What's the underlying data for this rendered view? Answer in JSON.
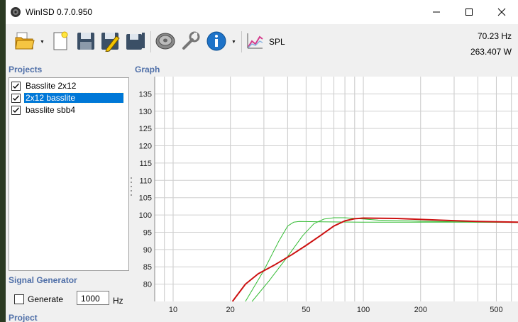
{
  "window": {
    "title": "WinISD 0.7.0.950"
  },
  "toolbar": {
    "spl_label": "SPL",
    "freq_readout": "70.23 Hz",
    "power_readout": "263.407 W"
  },
  "projects": {
    "section_label": "Projects",
    "items": [
      {
        "label": "Basslite 2x12",
        "checked": true,
        "selected": false
      },
      {
        "label": "2x12 basslite",
        "checked": true,
        "selected": true
      },
      {
        "label": "basslite sbb4",
        "checked": true,
        "selected": false
      }
    ]
  },
  "signal_generator": {
    "section_label": "Signal Generator",
    "generate_label": "Generate",
    "generate_checked": false,
    "frequency_value": "1000",
    "frequency_unit": "Hz"
  },
  "project_section_label": "Project",
  "graph": {
    "section_label": "Graph"
  },
  "chart_data": {
    "type": "line",
    "x_scale": "log",
    "xlim": [
      8,
      650
    ],
    "ylim": [
      75,
      140
    ],
    "x_ticks": [
      10,
      20,
      50,
      100,
      200,
      500
    ],
    "x_tick_labels": [
      "10",
      "20",
      "50",
      "100",
      "200",
      "500"
    ],
    "y_ticks": [
      80,
      85,
      90,
      95,
      100,
      105,
      110,
      115,
      120,
      125,
      130,
      135
    ],
    "y_tick_labels": [
      "80",
      "85",
      "90",
      "95",
      "100",
      "105",
      "110",
      "115",
      "120",
      "125",
      "130",
      "135"
    ],
    "grid": true,
    "series": [
      {
        "color": "#33bb33",
        "width": 1,
        "points": [
          [
            24,
            75
          ],
          [
            30,
            84
          ],
          [
            36,
            92.5
          ],
          [
            40,
            96.8
          ],
          [
            43,
            97.9
          ],
          [
            46,
            98.1
          ],
          [
            60,
            98.0
          ],
          [
            100,
            97.9
          ],
          [
            200,
            97.9
          ],
          [
            400,
            97.9
          ],
          [
            650,
            97.9
          ]
        ]
      },
      {
        "color": "#33bb33",
        "width": 1,
        "points": [
          [
            26,
            75
          ],
          [
            32,
            81
          ],
          [
            40,
            88
          ],
          [
            48,
            94
          ],
          [
            55,
            97.5
          ],
          [
            62,
            98.8
          ],
          [
            70,
            99.2
          ],
          [
            80,
            99.2
          ],
          [
            95,
            98.9
          ],
          [
            120,
            98.5
          ],
          [
            200,
            98.2
          ],
          [
            400,
            97.9
          ],
          [
            650,
            97.8
          ]
        ]
      },
      {
        "color": "#cc1111",
        "width": 2,
        "points": [
          [
            20.5,
            75
          ],
          [
            24,
            80
          ],
          [
            28,
            83
          ],
          [
            34,
            85.5
          ],
          [
            42,
            88.5
          ],
          [
            50,
            91.2
          ],
          [
            60,
            94.2
          ],
          [
            70,
            96.8
          ],
          [
            80,
            98.3
          ],
          [
            90,
            98.9
          ],
          [
            100,
            99.1
          ],
          [
            150,
            99.0
          ],
          [
            250,
            98.5
          ],
          [
            400,
            98.1
          ],
          [
            650,
            97.9
          ]
        ]
      }
    ]
  }
}
